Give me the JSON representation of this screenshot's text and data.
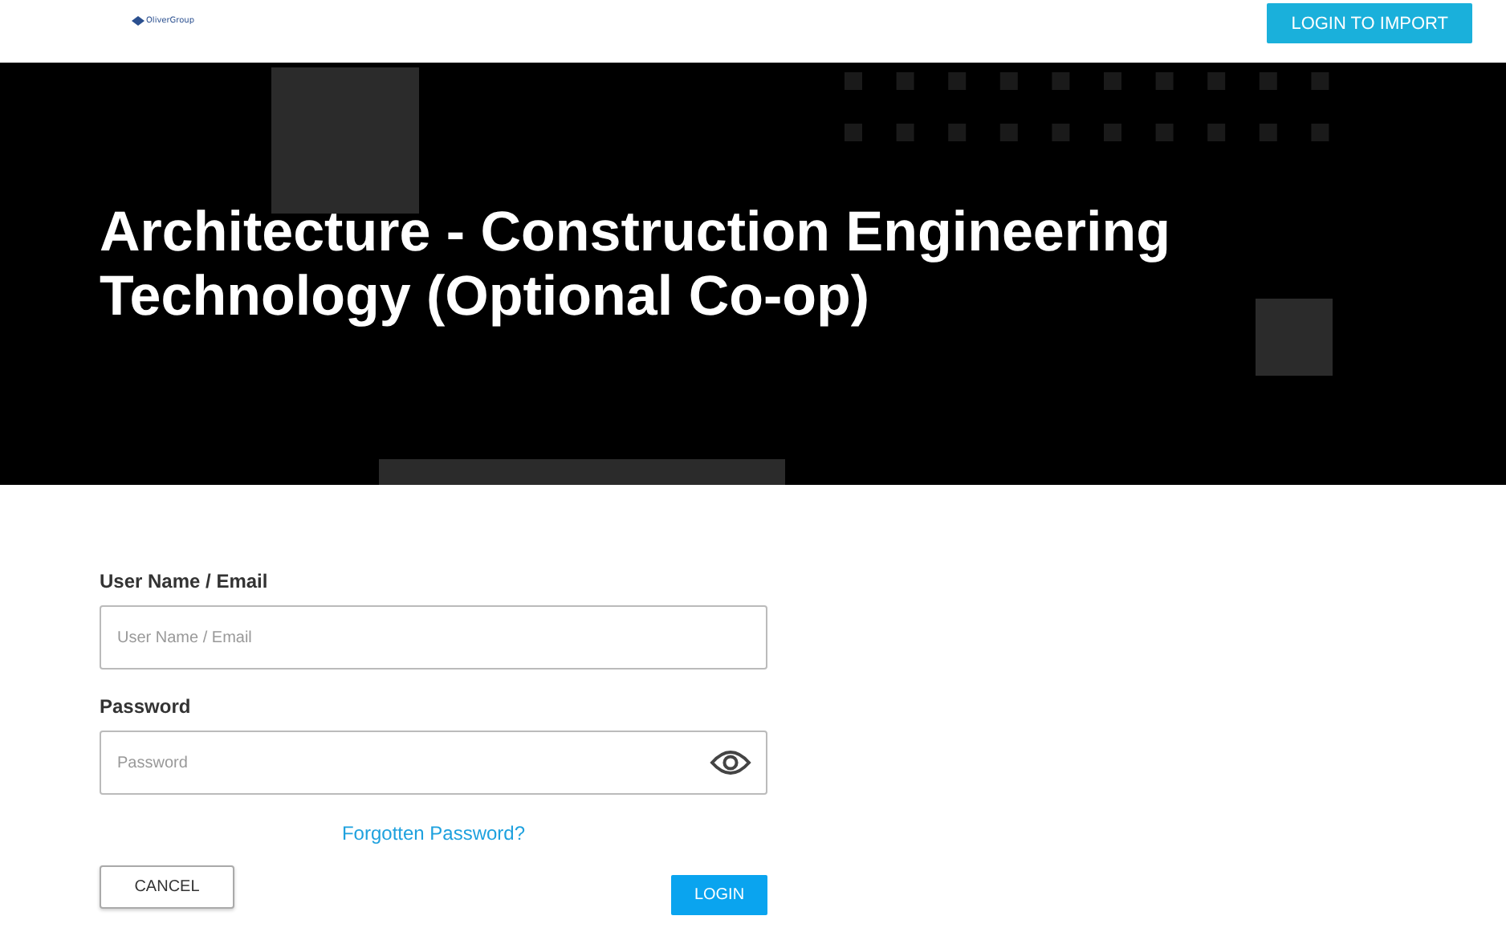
{
  "header": {
    "logo": "OliverGroup",
    "action_button": "LOGIN TO IMPORT"
  },
  "hero": {
    "title": "Architecture - Construction Engineering Technology (Optional Co-op)"
  },
  "form": {
    "fields": [
      {
        "label": "User Name / Email",
        "placeholder": "User Name / Email",
        "kind": "text"
      },
      {
        "label": "Password",
        "placeholder": "Password",
        "kind": "password"
      }
    ],
    "forgot_link": "Forgotten Password?",
    "cancel_button": "CANCEL",
    "login_button": "LOGIN"
  }
}
